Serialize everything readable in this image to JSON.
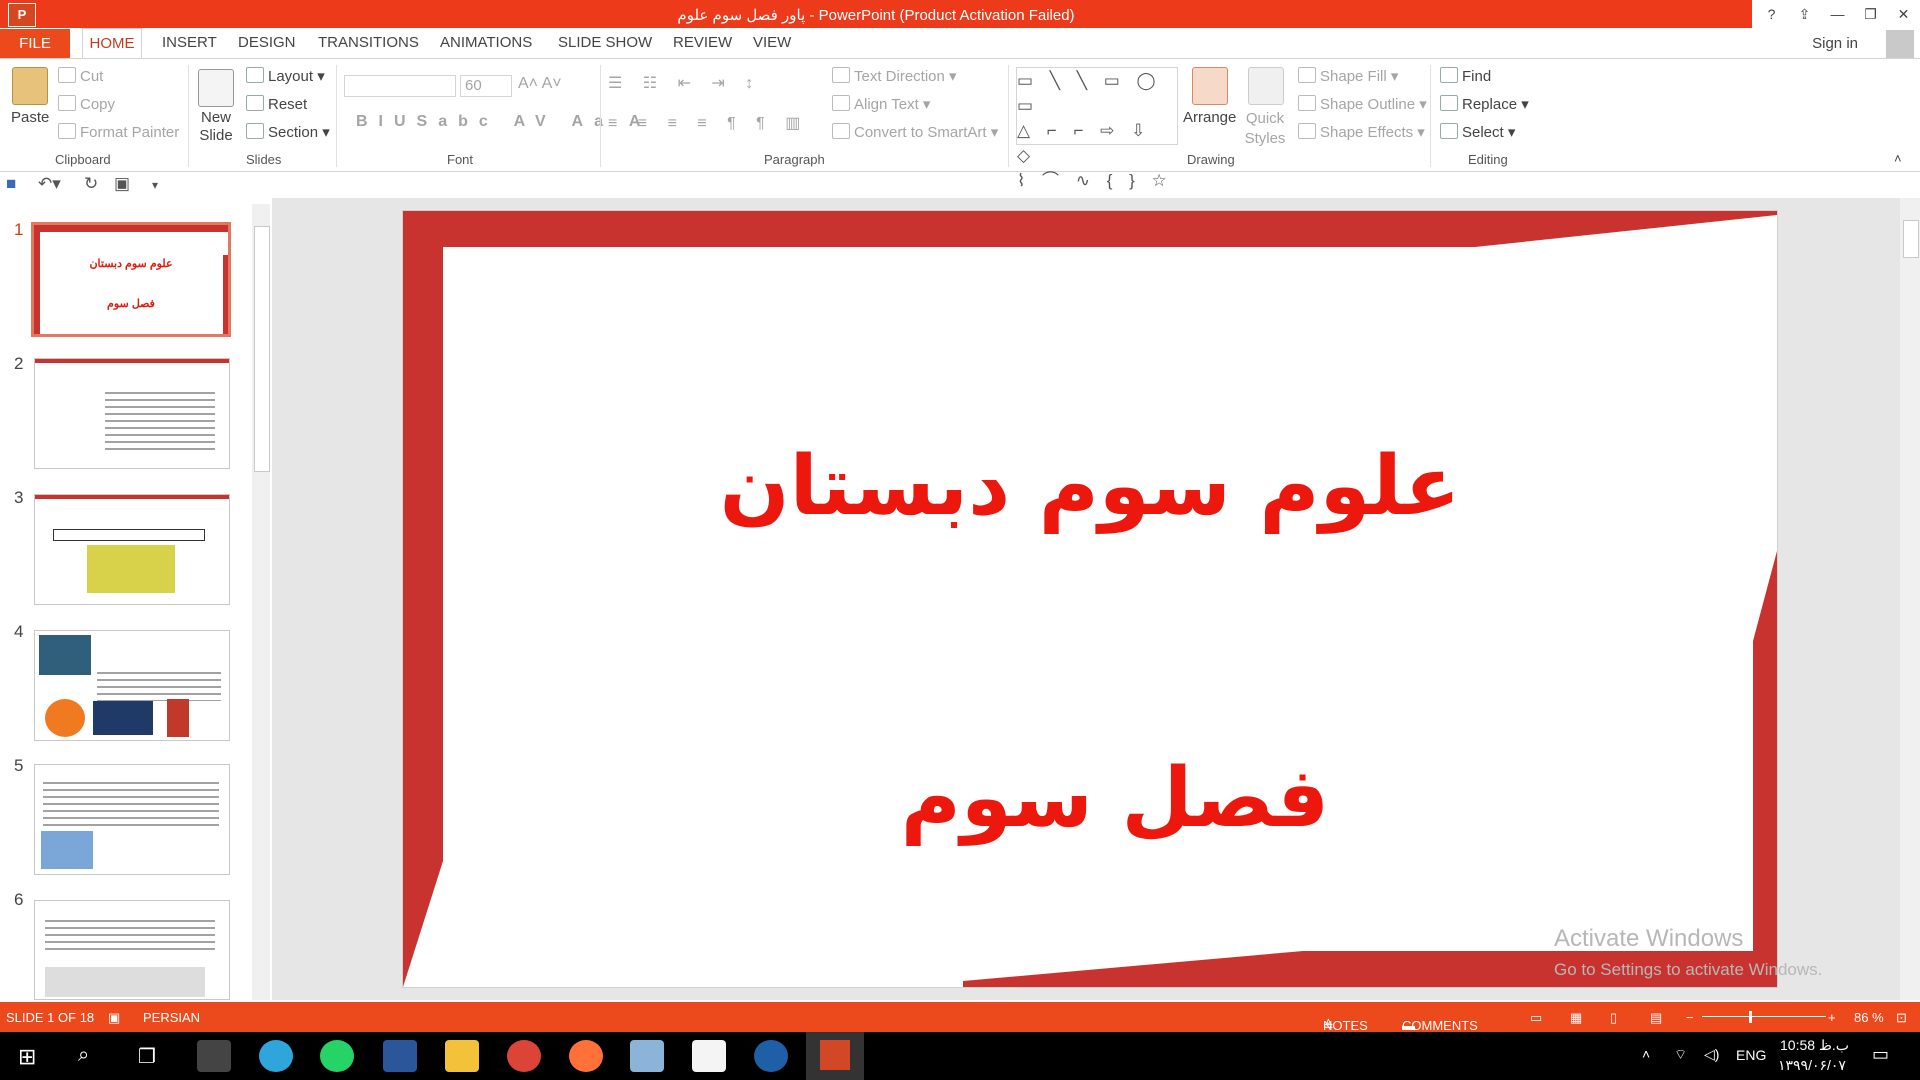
{
  "window": {
    "title": "پاور فصل سوم علوم  -  PowerPoint (Product Activation Failed)",
    "app_icon": "P"
  },
  "window_controls": [
    "?",
    "⇪",
    "—",
    "❐",
    "✕"
  ],
  "tabs": {
    "file": "FILE",
    "home": "HOME",
    "items": [
      "INSERT",
      "DESIGN",
      "TRANSITIONS",
      "ANIMATIONS",
      "SLIDE SHOW",
      "REVIEW",
      "VIEW"
    ],
    "sign_in": "Sign in"
  },
  "ribbon": {
    "clipboard": {
      "label": "Clipboard",
      "paste": "Paste",
      "cut": "Cut",
      "copy": "Copy",
      "format_painter": "Format Painter"
    },
    "slides": {
      "label": "Slides",
      "new_slide": "New Slide",
      "layout": "Layout",
      "reset": "Reset",
      "section": "Section"
    },
    "font": {
      "label": "Font",
      "size": "60"
    },
    "paragraph": {
      "label": "Paragraph",
      "text_direction": "Text Direction",
      "align_text": "Align Text",
      "convert": "Convert to SmartArt"
    },
    "drawing": {
      "label": "Drawing",
      "arrange": "Arrange",
      "quick_styles": "Quick Styles",
      "shape_fill": "Shape Fill",
      "shape_outline": "Shape Outline",
      "shape_effects": "Shape Effects"
    },
    "editing": {
      "label": "Editing",
      "find": "Find",
      "replace": "Replace",
      "select": "Select"
    }
  },
  "slides": [
    {
      "num": "1",
      "line1": "علوم سوم دبستان",
      "line2": "فصل سوم"
    },
    {
      "num": "2"
    },
    {
      "num": "3"
    },
    {
      "num": "4"
    },
    {
      "num": "5"
    },
    {
      "num": "6"
    }
  ],
  "slide": {
    "title": "علوم سوم دبستان",
    "subtitle": "فصل سوم"
  },
  "watermark": {
    "line1": "Activate Windows",
    "line2": "Go to Settings to activate Windows."
  },
  "status": {
    "slide": "SLIDE 1 OF 18",
    "language": "PERSIAN",
    "notes": "NOTES",
    "comments": "COMMENTS",
    "zoom": "86 %"
  },
  "taskbar": {
    "lang": "ENG",
    "time": "10:58 ب.ظ",
    "date": "۱۳۹۹/۰۶/۰۷"
  },
  "colors": {
    "accent": "#ec4a1c",
    "slide_frame": "#c9332f",
    "title_red": "#ec180e"
  }
}
